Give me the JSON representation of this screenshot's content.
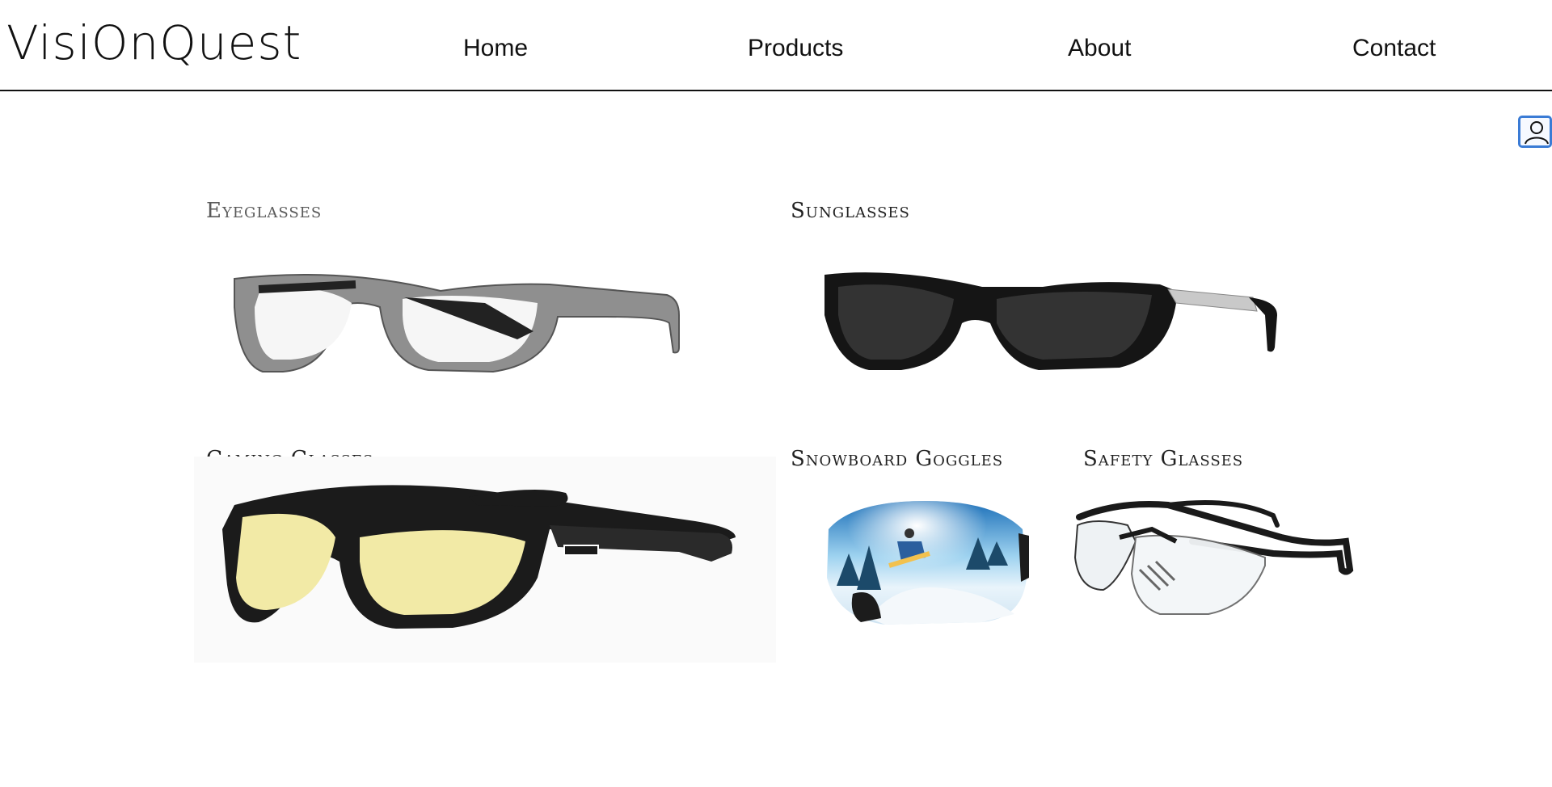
{
  "brand": {
    "logo_text": "VisiOnQuest"
  },
  "nav": {
    "home": "Home",
    "products": "Products",
    "about": "About",
    "contact": "Contact"
  },
  "icons": {
    "profile": "user-icon"
  },
  "categories": [
    {
      "label": "Eyeglasses"
    },
    {
      "label": "Sunglasses"
    },
    {
      "label": "Gaming Glasses"
    },
    {
      "label": "Snowboard Goggles"
    },
    {
      "label": "Safety Glasses"
    }
  ],
  "colors": {
    "accent": "#3a7bd5",
    "text": "#111111",
    "lens_yellow": "#f2eaa6",
    "frame_gray": "#8c8c8c"
  }
}
